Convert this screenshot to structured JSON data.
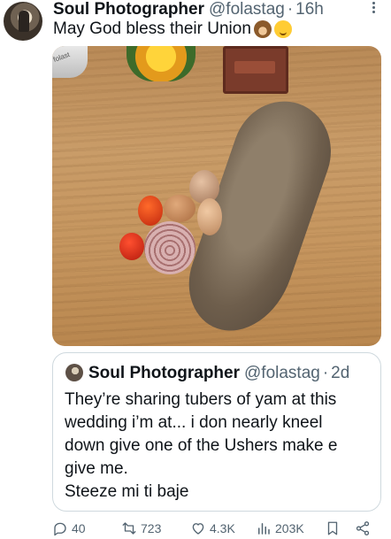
{
  "tweet": {
    "author_name": "Soul Photographer",
    "author_handle": "@folastag",
    "separator": "·",
    "time": "16h",
    "text": "May God bless their Union",
    "emojis": [
      "see-no-evil-monkey-emoji",
      "face-with-hand-over-mouth-emoji"
    ]
  },
  "media": {
    "bottle_label": "folast"
  },
  "quoted": {
    "author_name": "Soul Photographer",
    "author_handle": "@folastag",
    "separator": "·",
    "time": "2d",
    "lines": [
      "They’re sharing tubers of yam at this",
      "wedding i’m at... i don nearly kneel",
      "down give one of the Ushers make e",
      "give me.",
      "Steeze mi ti baje"
    ]
  },
  "actions": {
    "replies": "40",
    "reposts": "723",
    "likes": "4.3K",
    "views": "203K"
  },
  "icons": {
    "more": "more-icon",
    "reply": "reply-icon",
    "repost": "repost-icon",
    "like": "heart-icon",
    "views": "views-icon",
    "bookmark": "bookmark-icon",
    "share": "share-icon"
  },
  "colors": {
    "text": "#0f1419",
    "secondary": "#536471",
    "border": "#cfd9de"
  }
}
